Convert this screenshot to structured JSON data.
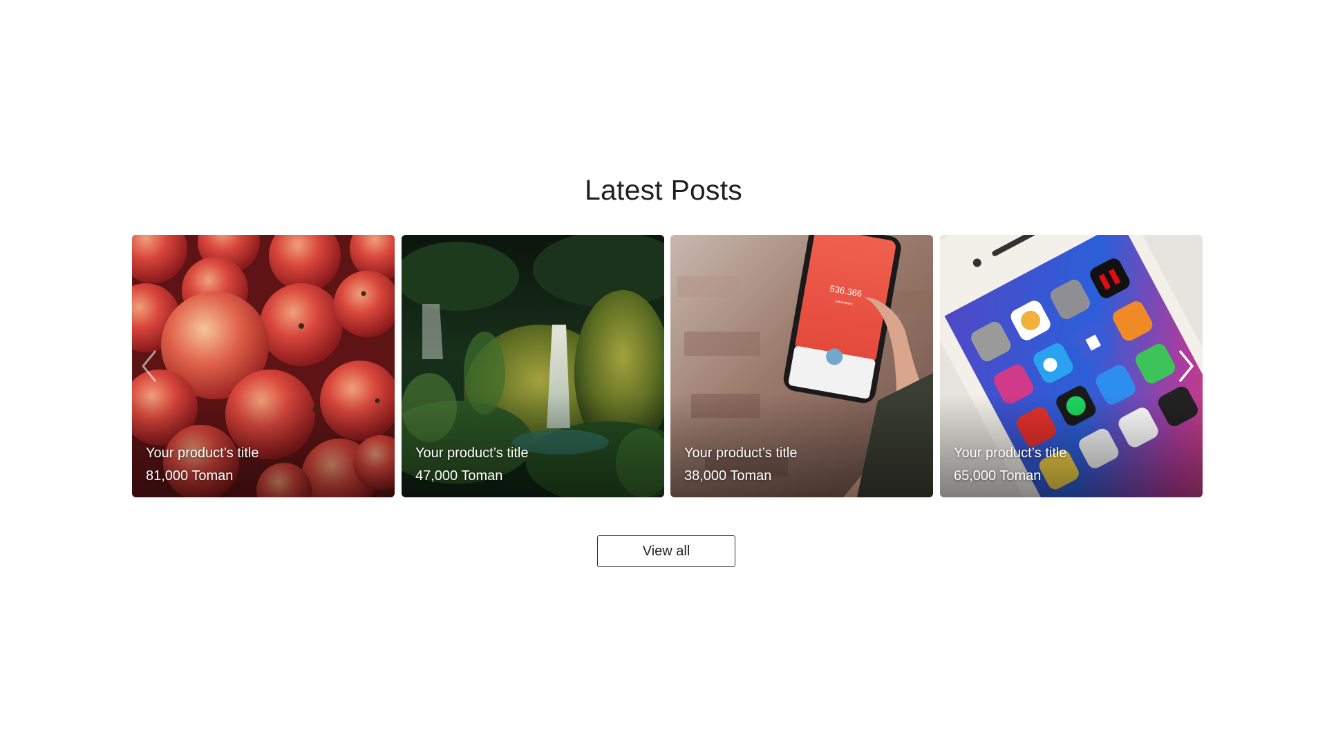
{
  "section": {
    "title": "Latest Posts"
  },
  "products": [
    {
      "title": "Your product’s title",
      "price": "81,000 Toman",
      "image": "apples-image"
    },
    {
      "title": "Your product’s title",
      "price": "47,000 Toman",
      "image": "waterfall-image"
    },
    {
      "title": "Your product’s title",
      "price": "38,000 Toman",
      "image": "phone-in-hand-image"
    },
    {
      "title": "Your product’s title",
      "price": "65,000 Toman",
      "image": "phone-home-screen-image"
    }
  ],
  "carousel": {
    "prev_icon": "chevron-left-icon",
    "next_icon": "chevron-right-icon"
  },
  "actions": {
    "view_all_label": "View all"
  },
  "colors": {
    "background": "#ffffff",
    "title": "#1f1f1f",
    "caption_text": "#ffffff",
    "button_border": "#333333"
  },
  "phone_screen": {
    "count": "536.366",
    "count_label": "subscribers"
  }
}
